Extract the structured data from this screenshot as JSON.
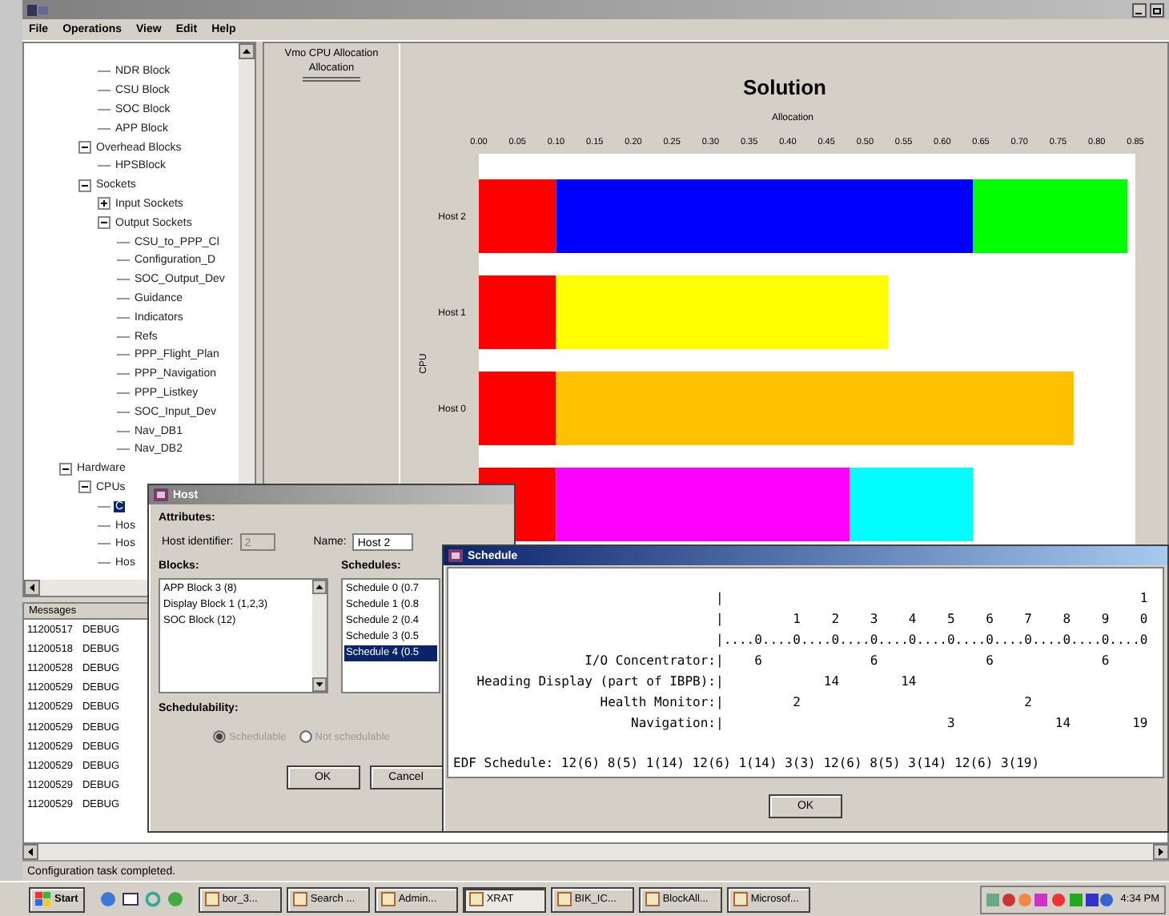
{
  "window": {
    "menu": [
      "File",
      "Operations",
      "View",
      "Edit",
      "Help"
    ]
  },
  "tree": [
    {
      "children": [
        {
          "children": [
            {
              "label": "NDR Block",
              "selected": false
            },
            {
              "label": "CSU Block",
              "selected": false
            },
            {
              "label": "SOC Block",
              "selected": false
            },
            {
              "label": "APP Block",
              "selected": false
            }
          ]
        },
        {
          "label": "Overhead Blocks",
          "selected": false,
          "expanded": true,
          "children": [
            {
              "label": "HPSBlock",
              "selected": false
            }
          ]
        },
        {
          "label": "Sockets",
          "selected": false,
          "expanded": true,
          "children": [
            {
              "label": "Input Sockets",
              "selected": false,
              "expanded": false
            },
            {
              "label": "Output Sockets",
              "selected": false,
              "expanded": true,
              "children": [
                {
                  "label": "CSU_to_PPP_Cl",
                  "selected": false
                },
                {
                  "label": "Configuration_D",
                  "selected": false
                },
                {
                  "label": "SOC_Output_Dev",
                  "selected": false
                },
                {
                  "label": "Guidance",
                  "selected": false
                },
                {
                  "label": "Indicators",
                  "selected": false
                },
                {
                  "label": "Refs",
                  "selected": false
                },
                {
                  "label": "PPP_Flight_Plan",
                  "selected": false
                },
                {
                  "label": "PPP_Navigation",
                  "selected": false
                },
                {
                  "label": "PPP_Listkey",
                  "selected": false
                },
                {
                  "label": "SOC_Input_Dev",
                  "selected": false
                },
                {
                  "label": "Nav_DB1",
                  "selected": false
                },
                {
                  "label": "Nav_DB2",
                  "selected": false
                }
              ]
            }
          ]
        }
      ]
    },
    {
      "label": "Hardware",
      "selected": false,
      "expanded": true,
      "children": [
        {
          "label": "CPUs",
          "selected": false,
          "expanded": true,
          "children": [
            {
              "label": "C",
              "selected": true
            },
            {
              "label": "Hos",
              "selected": false
            },
            {
              "label": "Hos",
              "selected": false
            },
            {
              "label": "Hos",
              "selected": false
            }
          ]
        }
      ]
    }
  ],
  "panel": {
    "header": "Vmo CPU Allocation",
    "tabs": [
      {
        "label": "Allocation",
        "selected": true
      }
    ]
  },
  "chart": {
    "chart_data": {
      "type": "bar",
      "orientation": "horizontal",
      "stacked": true,
      "title": "Solution",
      "xlabel": "Allocation",
      "ylabel": "CPU",
      "categories": [
        "Host 2",
        "Host 1",
        "Host 0",
        null
      ],
      "xlim": [
        0,
        0.85
      ],
      "xticks": [
        {
          "value": 0,
          "label": "0.00"
        },
        {
          "value": 0.05,
          "label": "0.05"
        },
        {
          "value": 0.1,
          "label": "0.10"
        },
        {
          "value": 0.15,
          "label": "0.15"
        },
        {
          "value": 0.2,
          "label": "0.20"
        },
        {
          "value": 0.25,
          "label": "0.25"
        },
        {
          "value": 0.3,
          "label": "0.30"
        },
        {
          "value": 0.35,
          "label": "0.35"
        },
        {
          "value": 0.4,
          "label": "0.40"
        },
        {
          "value": 0.45,
          "label": "0.45"
        },
        {
          "value": 0.5,
          "label": "0.50"
        },
        {
          "value": 0.55,
          "label": "0.55"
        },
        {
          "value": 0.6,
          "label": "0.60"
        },
        {
          "value": 0.65,
          "label": "0.65"
        },
        {
          "value": 0.7,
          "label": "0.70"
        },
        {
          "value": 0.75,
          "label": "0.75"
        },
        {
          "value": 0.8,
          "label": "0.80"
        },
        {
          "value": 0.85,
          "label": "0.85"
        }
      ],
      "series": [
        {
          "color": "#ff0000",
          "values": [
            0.1,
            0.1,
            0.1,
            0.1
          ]
        },
        {
          "color": "#0000ff",
          "values": [
            0.54,
            null,
            null,
            null
          ]
        },
        {
          "color": "#00ff00",
          "values": [
            0.2,
            null,
            null,
            null
          ]
        },
        {
          "color": "#ffff00",
          "values": [
            null,
            0.43,
            null,
            null
          ]
        },
        {
          "color": "#ffc000",
          "values": [
            null,
            null,
            0.67,
            null
          ]
        },
        {
          "color": "#ff00ff",
          "values": [
            null,
            null,
            null,
            0.38
          ]
        },
        {
          "color": "#00ffff",
          "values": [
            null,
            null,
            null,
            0.16
          ]
        }
      ]
    }
  },
  "messages": {
    "header": "Messages",
    "rows": [
      {
        "id": "11200517",
        "severity": "DEBUG"
      },
      {
        "id": "11200518",
        "severity": "DEBUG"
      },
      {
        "id": "11200528",
        "severity": "DEBUG"
      },
      {
        "id": "11200529",
        "severity": "DEBUG"
      },
      {
        "id": "11200529",
        "severity": "DEBUG"
      },
      {
        "id": "11200529",
        "severity": "DEBUG"
      },
      {
        "id": "11200529",
        "severity": "DEBUG"
      },
      {
        "id": "11200529",
        "severity": "DEBUG"
      },
      {
        "id": "11200529",
        "severity": "DEBUG"
      },
      {
        "id": "11200529",
        "severity": "DEBUG"
      }
    ]
  },
  "status": "Configuration task completed.",
  "host_dialog": {
    "title": "Host",
    "attributes_heading": "Attributes:",
    "host_identifier": {
      "label": "Host identifier:",
      "value": "2",
      "disabled": true
    },
    "name": {
      "label": "Name:",
      "value": "Host 2"
    },
    "blocks": {
      "heading": "Blocks:",
      "items": [
        {
          "label": "APP Block 3 (8)",
          "selected": false
        },
        {
          "label": "Display Block 1 (1,2,3)",
          "selected": false
        },
        {
          "label": "SOC Block (12)",
          "selected": false
        }
      ]
    },
    "schedules": {
      "heading": "Schedules:",
      "items": [
        {
          "label": "Schedule 0 (0.7",
          "selected": false
        },
        {
          "label": "Schedule 1 (0.8",
          "selected": false
        },
        {
          "label": "Schedule 2 (0.4",
          "selected": false
        },
        {
          "label": "Schedule 3 (0.5",
          "selected": false
        },
        {
          "label": "Schedule 4 (0.5",
          "selected": true
        }
      ]
    },
    "schedulability": {
      "heading": "Schedulability:",
      "options": [
        {
          "label": "Schedulable",
          "selected": true,
          "disabled": true
        },
        {
          "label": "Not schedulable",
          "selected": false,
          "disabled": true
        }
      ]
    },
    "buttons": [
      "OK",
      "Cancel"
    ]
  },
  "schedule_dialog": {
    "title": "Schedule",
    "rows": [
      {
        "marks": "|                                                      1"
      },
      {
        "marks": "|         1    2    3    4    5    6    7    8    9    0"
      },
      {
        "marks": "|....0....0....0....0....0....0....0....0....0....0....0"
      },
      {
        "label": "I/O Concentrator:",
        "marks": "|    6              6              6              6"
      },
      {
        "label": "Heading Display (part of IBPB):",
        "marks": "|             14        14"
      },
      {
        "label": "Health Monitor:",
        "marks": "|         2                             2"
      },
      {
        "label": "Navigation:",
        "marks": "|                             3             14        19"
      }
    ],
    "edf": "EDF Schedule: 12(6) 8(5) 1(14) 12(6) 1(14) 3(3) 12(6) 8(5) 3(14) 12(6) 3(19)",
    "buttons": [
      "OK"
    ]
  },
  "taskbar": {
    "start": "Start",
    "tasks": [
      {
        "label": "bor_3...",
        "selected": false
      },
      {
        "label": "Search ...",
        "selected": false
      },
      {
        "label": "Admin...",
        "selected": false
      },
      {
        "label": "XRAT",
        "selected": true
      },
      {
        "label": "BIK_IC...",
        "selected": false
      },
      {
        "label": "BlockAll...",
        "selected": false
      },
      {
        "label": "Microsof...",
        "selected": false
      }
    ],
    "clock": "4:34 PM"
  }
}
